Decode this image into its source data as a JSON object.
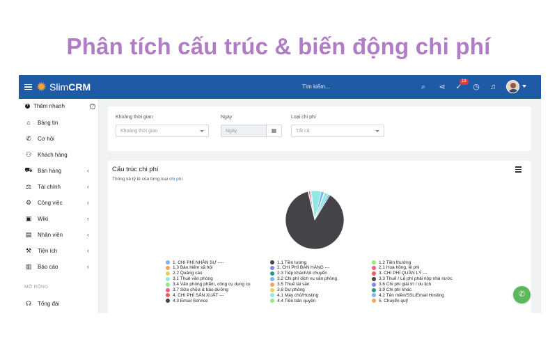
{
  "headline": "Phân tích cấu trúc & biến động chi phí",
  "topbar": {
    "logo_text": "Slim",
    "logo_bold": "CRM",
    "search_placeholder": "Tìm kiếm...",
    "notification_count": "18",
    "color": "#1f5aa6"
  },
  "sidebar": {
    "quick_add": "Thêm nhanh",
    "help": "?",
    "section_label": "MỞ RỘNG",
    "items": [
      {
        "label": "Bảng tin",
        "icon": "home-icon",
        "glyph": "⌂"
      },
      {
        "label": "Cơ hội",
        "icon": "phone-icon",
        "glyph": "✆"
      },
      {
        "label": "Khách hàng",
        "icon": "user-icon",
        "glyph": "⚇"
      },
      {
        "label": "Bán hàng",
        "icon": "cart-icon",
        "glyph": "⛟"
      },
      {
        "label": "Tài chính",
        "icon": "scale-icon",
        "glyph": "⚖"
      },
      {
        "label": "Công việc",
        "icon": "handshake-icon",
        "glyph": "⚙"
      },
      {
        "label": "Wiki",
        "icon": "wiki-icon",
        "glyph": "▣"
      },
      {
        "label": "Nhân viên",
        "icon": "id-card-icon",
        "glyph": "▤"
      },
      {
        "label": "Tiện ích",
        "icon": "wrench-icon",
        "glyph": "⚒"
      },
      {
        "label": "Báo cáo",
        "icon": "chart-icon",
        "glyph": "▥"
      },
      {
        "label": "Tổng đài",
        "icon": "headset-icon",
        "glyph": "☊"
      }
    ]
  },
  "filters": {
    "time_label": "Khoảng thời gian",
    "time_placeholder": "Khoảng thời gian",
    "date_label": "Ngày",
    "date_placeholder": "Ngày",
    "type_label": "Loại chi phí",
    "type_value": "Tất cả"
  },
  "chart_card": {
    "title": "Cấu trúc chi phí",
    "subtitle_prefix": "Thống kê tỷ lệ của từng loại ",
    "subtitle_link": "chi phí"
  },
  "chart_data": {
    "type": "pie",
    "slices": [
      {
        "label": "1. CHI PHÍ NHÂN SỰ ----",
        "color": "#7cb5ec",
        "value": 0
      },
      {
        "label": "1.1 Tiền lương",
        "color": "#434348",
        "value": 87.5
      },
      {
        "label": "1.2 Tiền thưởng",
        "color": "#90ed7d",
        "value": 0.4
      },
      {
        "label": "1.3 Bảo hiểm xã hội",
        "color": "#f7a35c",
        "value": 0
      },
      {
        "label": "2. CHI PHÍ BÁN HÀNG ---",
        "color": "#8085e9",
        "value": 0
      },
      {
        "label": "2.1 Hoa hồng, lệ phí",
        "color": "#f15c80",
        "value": 0.8
      },
      {
        "label": "2.2 Quảng cáo",
        "color": "#e4d354",
        "value": 0.3
      },
      {
        "label": "2.3 Tiếp khách/di chuyển",
        "color": "#2b908f",
        "value": 0.4
      },
      {
        "label": "3. CHI PHÍ QUẢN LÝ ---",
        "color": "#f45b5b",
        "value": 0
      },
      {
        "label": "3.1 Thuê văn phòng",
        "color": "#91e8e1",
        "value": 5.5
      },
      {
        "label": "3.2 Chi phí dịch vụ văn phòng",
        "color": "#7cb5ec",
        "value": 1.6
      },
      {
        "label": "3.3 Thuế / Lệ phí phải nộp nhà nước",
        "color": "#434348",
        "value": 0
      },
      {
        "label": "3.4 Văn phòng phẩm, công cụ dụng cụ",
        "color": "#90ed7d",
        "value": 0.3
      },
      {
        "label": "3.5 Thuế tài sản",
        "color": "#f7a35c",
        "value": 0
      },
      {
        "label": "3.6 Chi phí giải trí / du lịch",
        "color": "#8085e9",
        "value": 0
      },
      {
        "label": "3.7 Sửa chữa & bảo dưỡng",
        "color": "#f15c80",
        "value": 0
      },
      {
        "label": "3.8 Dự phòng",
        "color": "#e4d354",
        "value": 0
      },
      {
        "label": "3.9 Chi phí khác",
        "color": "#2b908f",
        "value": 0
      },
      {
        "label": "4. CHI PHÍ SẢN XUẤT ---",
        "color": "#f45b5b",
        "value": 0
      },
      {
        "label": "4.1 Máy chủ/Hosting",
        "color": "#91e8e1",
        "value": 2.2
      },
      {
        "label": "4.2 Tên miền/SSL/Email Hosting",
        "color": "#7cb5ec",
        "value": 1.0
      },
      {
        "label": "4.3 Email Service",
        "color": "#434348",
        "value": 0
      },
      {
        "label": "4.4 Tiền bản quyền",
        "color": "#90ed7d",
        "value": 0
      },
      {
        "label": "5. Chuyển quỹ",
        "color": "#f7a35c",
        "value": 0
      }
    ],
    "legend_placement": "bottom"
  },
  "fab": {
    "icon": "phone-icon"
  }
}
